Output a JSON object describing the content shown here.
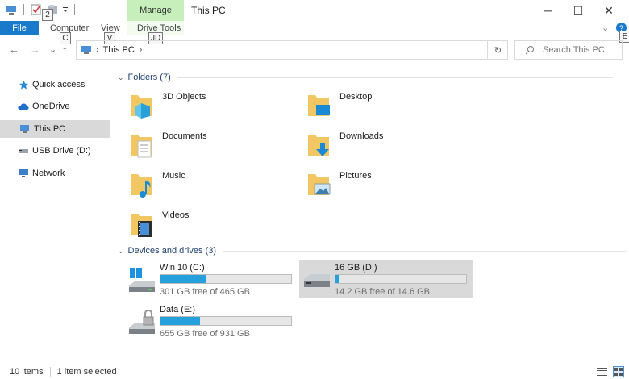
{
  "window": {
    "title": "This PC",
    "context_tab": "Manage",
    "minimize": "─",
    "maximize": "☐",
    "close": "✕"
  },
  "ribbon": {
    "file": "File",
    "tabs": [
      "Computer",
      "View",
      "Drive Tools"
    ],
    "keytips": {
      "qat": "2",
      "computer": "C",
      "view": "V",
      "drive_tools": "JD",
      "help": "E"
    }
  },
  "address": {
    "back": "←",
    "forward": "→",
    "recent": "⌄",
    "up": "↑",
    "path_sep": "›",
    "location": "This PC",
    "refresh": "↻",
    "search_placeholder": "Search This PC"
  },
  "navpane": {
    "items": [
      "Quick access",
      "OneDrive",
      "This PC",
      "USB Drive (D:)",
      "Network"
    ]
  },
  "folders": {
    "header": "Folders (7)",
    "items": [
      "3D Objects",
      "Desktop",
      "Documents",
      "Downloads",
      "Music",
      "Pictures",
      "Videos"
    ]
  },
  "drives": {
    "header": "Devices and drives (3)",
    "items": [
      {
        "name": "Win 10 (C:)",
        "free": "301 GB free of 465 GB",
        "used_pct": 35
      },
      {
        "name": "16 GB (D:)",
        "free": "14.2 GB free of 14.6 GB",
        "used_pct": 3
      },
      {
        "name": "Data (E:)",
        "free": "655 GB free of 931 GB",
        "used_pct": 30
      }
    ]
  },
  "status": {
    "count": "10 items",
    "selected": "1 item selected"
  },
  "colors": {
    "accent": "#1979ca",
    "manage": "#c6efbc",
    "bar": "#26a0da",
    "selected": "#d9d9d9",
    "header": "#1e3f70"
  }
}
